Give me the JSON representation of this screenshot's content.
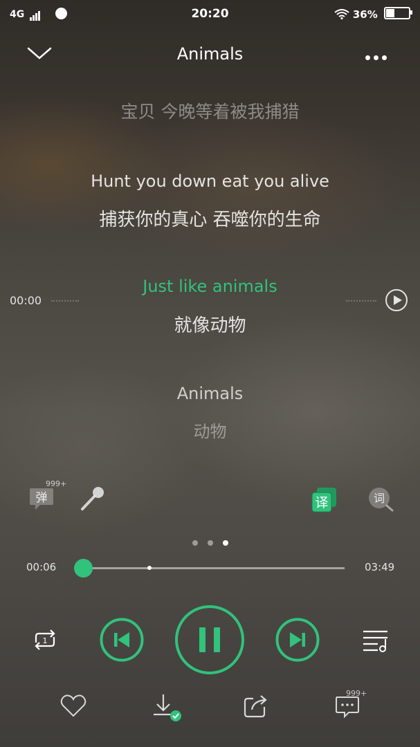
{
  "status_bar": {
    "network": "4G",
    "time": "20:20",
    "battery": "36%"
  },
  "header": {
    "title": "Animals"
  },
  "lyrics": [
    {
      "text": "宝贝 今晚等着被我捕猎",
      "state": "dim"
    },
    {
      "text": "Hunt you down eat you alive",
      "state": "normal"
    },
    {
      "text": "捕获你的真心 吞噬你的生命",
      "state": "normal"
    },
    {
      "text": "Just like animals",
      "state": "active"
    },
    {
      "text": "就像动物",
      "state": "active-translation"
    },
    {
      "text": "Animals",
      "state": "normal"
    },
    {
      "text": "动物",
      "state": "dim"
    }
  ],
  "lyric_seek_time": "00:00",
  "functions": {
    "danmu_label": "弹",
    "danmu_count": "999+",
    "translate_label": "译",
    "lyric_label": "词"
  },
  "progress": {
    "current": "00:06",
    "total": "03:49",
    "fraction": 0.027
  },
  "comment_count": "999+",
  "colors": {
    "accent": "#31c27c"
  }
}
